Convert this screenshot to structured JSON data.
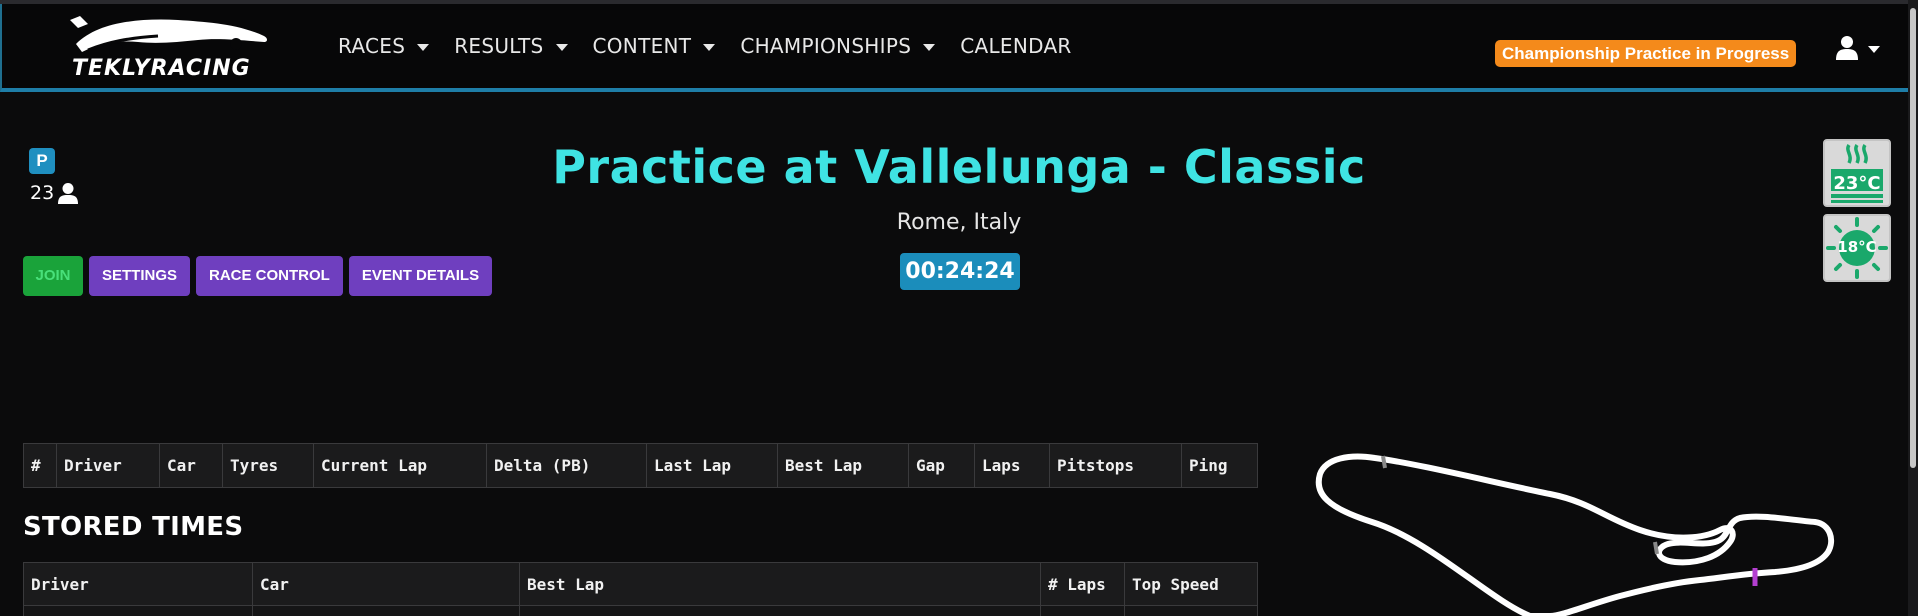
{
  "brand": {
    "logo_text": "TEKLYRACING"
  },
  "nav": {
    "items": [
      {
        "label": "RACES",
        "dropdown": true
      },
      {
        "label": "RESULTS",
        "dropdown": true
      },
      {
        "label": "CONTENT",
        "dropdown": true
      },
      {
        "label": "CHAMPIONSHIPS",
        "dropdown": true
      },
      {
        "label": "CALENDAR",
        "dropdown": false
      }
    ],
    "status_badge": "Championship Practice in Progress",
    "status_color": "#f48a1b",
    "user_icon": "user-icon"
  },
  "event": {
    "session_badge": "P",
    "driver_count": "23",
    "title": "Practice at Vallelunga - Classic",
    "location": "Rome, Italy",
    "timer": "00:24:24",
    "title_color": "#3fe3e3"
  },
  "actions": {
    "join": "JOIN",
    "settings": "SETTINGS",
    "race_control": "RACE CONTROL",
    "event_details": "EVENT DETAILS"
  },
  "weather": {
    "track_temp": "23°C",
    "track_icon": "road-heat-icon",
    "air_temp": "18°C",
    "air_icon": "sun-icon",
    "accent": "#1aa86b"
  },
  "live_table": {
    "columns": [
      "#",
      "Driver",
      "Car",
      "Tyres",
      "Current Lap",
      "Delta (PB)",
      "Last Lap",
      "Best Lap",
      "Gap",
      "Laps",
      "Pitstops",
      "Ping"
    ]
  },
  "stored_times": {
    "title": "STORED TIMES",
    "columns": [
      "Driver",
      "Car",
      "Best Lap",
      "# Laps",
      "Top Speed"
    ]
  }
}
